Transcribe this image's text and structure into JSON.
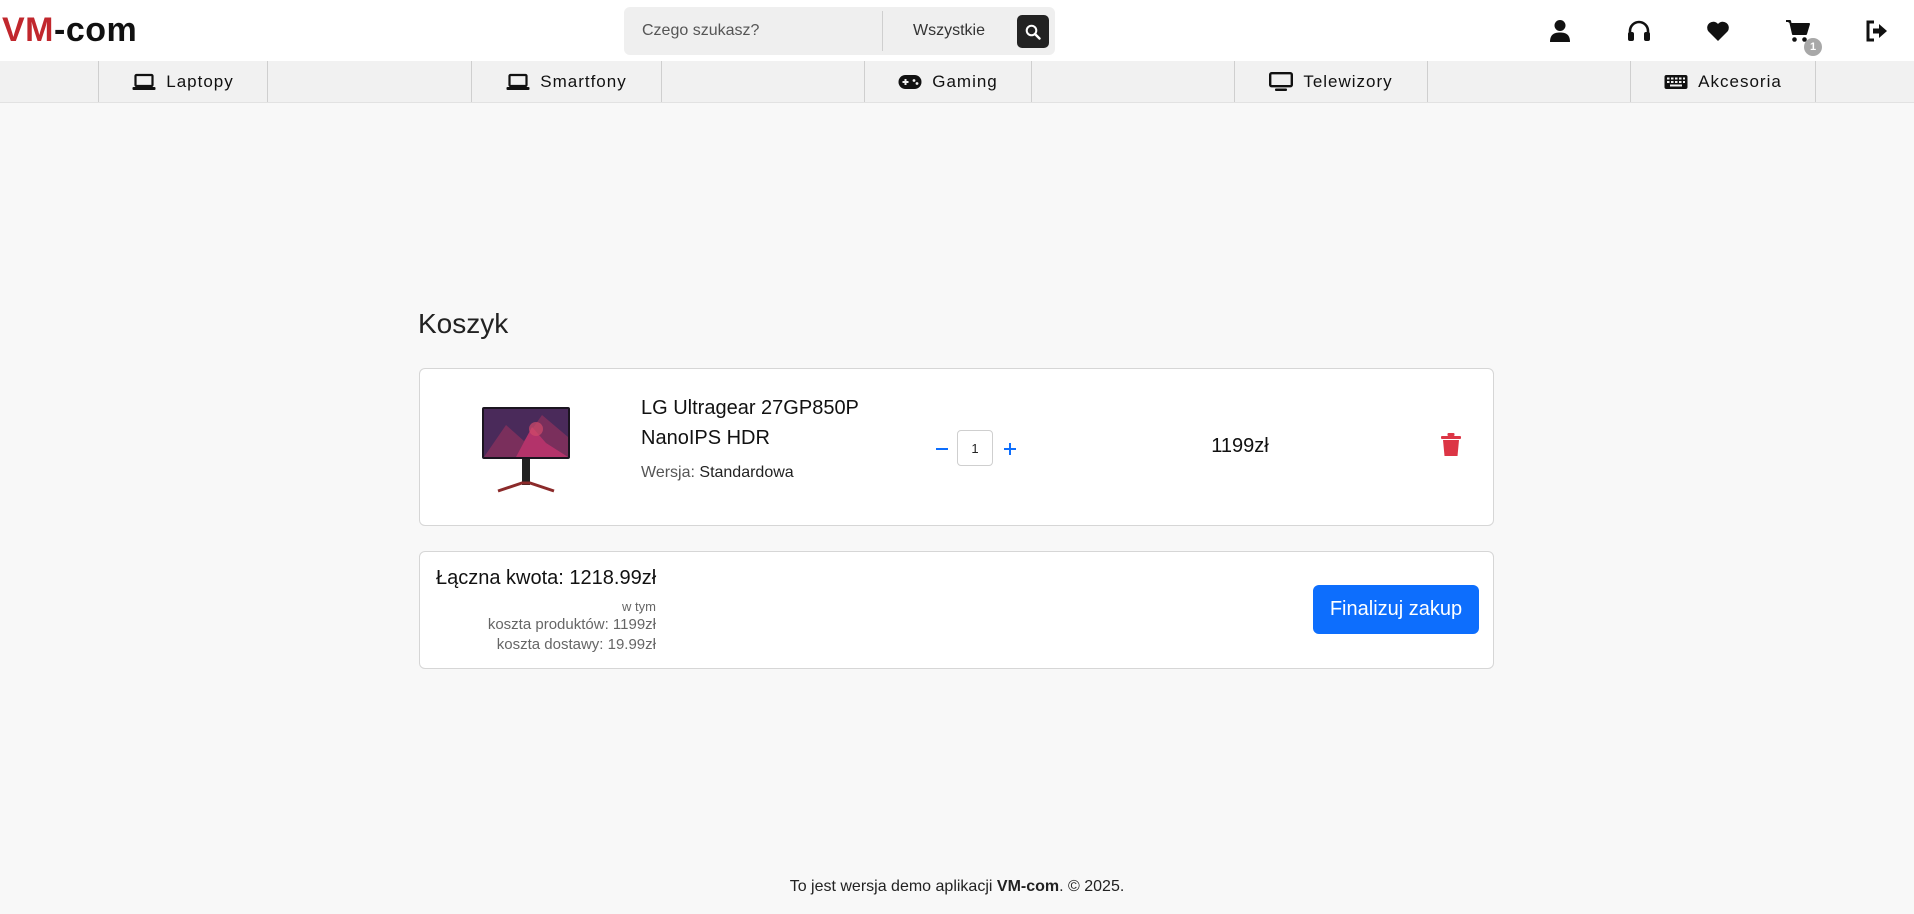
{
  "header": {
    "logo_part1": "VM",
    "logo_part2": "-com",
    "search": {
      "placeholder": "Czego szukasz?",
      "value": "",
      "category": "Wszystkie"
    },
    "cart_count": "1",
    "icons": [
      "user-icon",
      "headphones-icon",
      "heart-icon",
      "cart-icon",
      "logout-icon"
    ]
  },
  "categories": [
    {
      "label": "Laptopy",
      "icon": "laptop-icon"
    },
    {
      "label": "Smartfony",
      "icon": "laptop-icon"
    },
    {
      "label": "Gaming",
      "icon": "gamepad-icon"
    },
    {
      "label": "Telewizory",
      "icon": "tv-icon"
    },
    {
      "label": "Akcesoria",
      "icon": "keyboard-icon"
    }
  ],
  "main": {
    "title": "Koszyk",
    "items": [
      {
        "name": "LG Ultragear 27GP850P NanoIPS HDR",
        "version_label": "Wersja:",
        "version": "Standardowa",
        "quantity": "1",
        "price": "1199zł"
      }
    ],
    "summary": {
      "total_label": "Łączna kwota: 1218.99zł",
      "including": "w tym",
      "products_cost": "koszta produktów: 1199zł",
      "delivery_cost": "koszta dostawy: 19.99zł",
      "checkout_label": "Finalizuj zakup"
    }
  },
  "footer": {
    "text_before": "To jest wersja demo aplikacji ",
    "brand": "VM-com",
    "text_after": ". © 2025."
  },
  "colors": {
    "brand_red": "#c1272d",
    "primary": "#0d6efd",
    "danger": "#dc3545",
    "background": "#f8f8f8"
  }
}
